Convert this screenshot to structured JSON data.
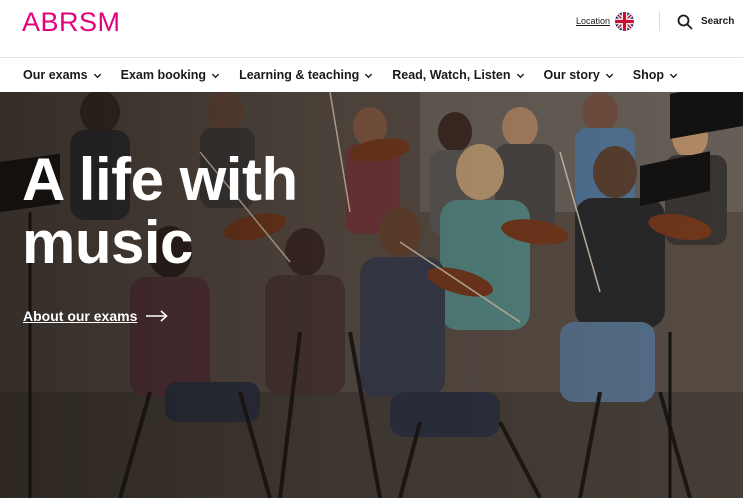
{
  "header": {
    "logo": "ABRSM",
    "location_label": "Location",
    "flag_icon": "uk-flag-icon",
    "search_label": "Search",
    "brand_color": "#e5007e"
  },
  "nav": {
    "items": [
      {
        "label": "Our exams"
      },
      {
        "label": "Exam booking"
      },
      {
        "label": "Learning & teaching"
      },
      {
        "label": "Read, Watch, Listen"
      },
      {
        "label": "Our story"
      },
      {
        "label": "Shop"
      }
    ]
  },
  "hero": {
    "headline_line1": "A life with",
    "headline_line2": "music",
    "cta_label": "About our exams"
  }
}
